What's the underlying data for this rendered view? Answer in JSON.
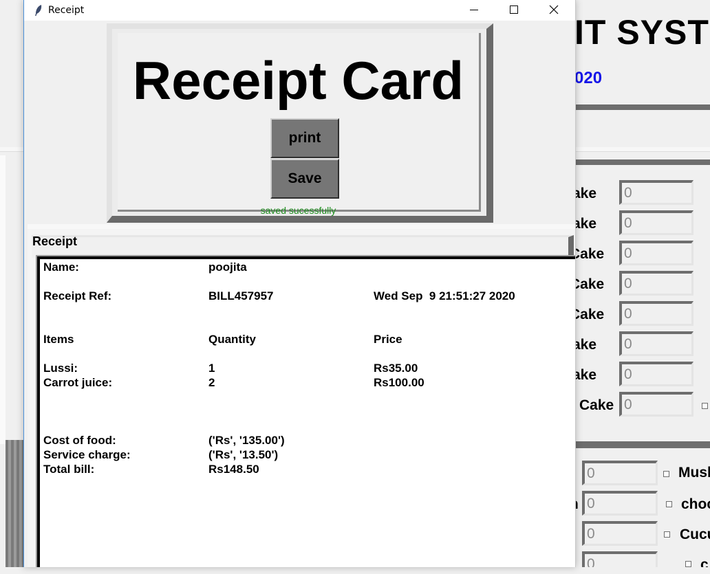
{
  "background_app": {
    "title_fragment": "IT SYSTE",
    "date_fragment": "020",
    "cake_items": [
      {
        "label": "ake",
        "value": "0"
      },
      {
        "label": "ake",
        "value": "0"
      },
      {
        "label": "Cake",
        "value": "0"
      },
      {
        "label": "Cake",
        "value": "0"
      },
      {
        "label": "Cake",
        "value": "0"
      },
      {
        "label": "ake",
        "value": "0"
      },
      {
        "label": "ake",
        "value": "0"
      },
      {
        "label": "Cake",
        "value": "0"
      }
    ],
    "drink_items": [
      {
        "prefix": "",
        "value": "0",
        "label": "Musl"
      },
      {
        "prefix": "n",
        "value": "0",
        "label": "choc"
      },
      {
        "prefix": "",
        "value": "0",
        "label": "Cucu"
      },
      {
        "prefix": "",
        "value": "0",
        "label": "c"
      }
    ]
  },
  "receipt_window": {
    "title": "Receipt",
    "card_title": "Receipt Card",
    "print_label": "print",
    "save_label": "Save",
    "status_message": "saved sucessfully",
    "receipt_section_label": "Receipt",
    "receipt": {
      "name_label": "Name:",
      "name_value": "poojita",
      "ref_label": "Receipt Ref:",
      "ref_value": "BILL457957",
      "datetime": "Wed Sep  9 21:51:27 2020",
      "headers": {
        "items": "Items",
        "quantity": "Quantity",
        "price": "Price"
      },
      "line_items": [
        {
          "item": "Lussi:",
          "quantity": "1",
          "price": "Rs35.00"
        },
        {
          "item": "Carrot juice:",
          "quantity": "2",
          "price": "Rs100.00"
        }
      ],
      "cost_label": "Cost of food:",
      "cost_value": "('Rs', '135.00')",
      "service_label": "Service charge:",
      "service_value": "('Rs', '13.50')",
      "total_label": "Total bill:",
      "total_value": "Rs148.50"
    }
  }
}
